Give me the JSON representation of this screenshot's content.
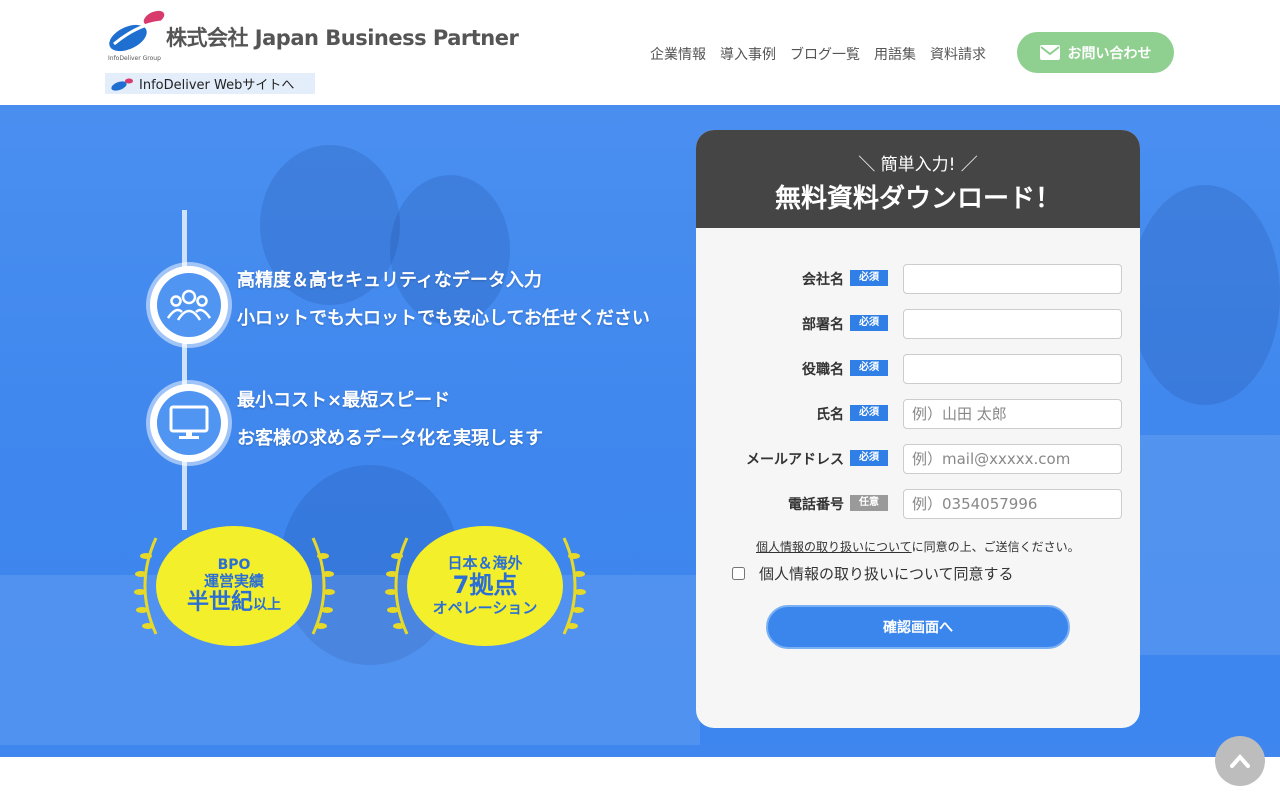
{
  "header": {
    "logo_text": "株式会社 Japan Business Partner",
    "logo_sub": "InfoDeliver Group",
    "infodeliver_link": "InfoDeliver Webサイトへ",
    "nav": [
      "企業情報",
      "導入事例",
      "ブログ一覧",
      "用語集",
      "資料請求"
    ],
    "contact_label": "お問い合わせ"
  },
  "hero": {
    "features": [
      {
        "line1": "高精度＆高セキュリティなデータ入力",
        "line2": "小ロットでも大ロットでも安心してお任せください",
        "icon": "people-icon"
      },
      {
        "line1": "最小コスト×最短スピード",
        "line2": "お客様の求めるデータ化を実現します",
        "icon": "monitor-icon"
      }
    ],
    "badges": [
      {
        "l1": "BPO",
        "l2": "運営実績",
        "l3": "半世紀",
        "l3b": "以上"
      },
      {
        "l1": "日本＆海外",
        "l2": "7拠点",
        "l3": "オペレーション"
      }
    ]
  },
  "form": {
    "subtitle": "＼ 簡単入力! ／",
    "title": "無料資料ダウンロード！",
    "fields": [
      {
        "label": "会社名",
        "badge": "必須",
        "placeholder": ""
      },
      {
        "label": "部署名",
        "badge": "必須",
        "placeholder": ""
      },
      {
        "label": "役職名",
        "badge": "必須",
        "placeholder": ""
      },
      {
        "label": "氏名",
        "badge": "必須",
        "placeholder": "例）山田 太郎"
      },
      {
        "label": "メールアドレス",
        "badge": "必須",
        "placeholder": "例）mail@xxxxx.com"
      },
      {
        "label": "電話番号",
        "badge": "任意",
        "placeholder": "例）0354057996"
      }
    ],
    "privacy_link": "個人情報の取り扱いについて",
    "privacy_rest": "に同意の上、ご送信ください。",
    "agree_label": "個人情報の取り扱いについて同意する",
    "submit_label": "確認画面へ"
  },
  "colors": {
    "accent": "#3b86ec",
    "contact": "#8fcf8f",
    "badge_yellow": "#f3ef2a"
  }
}
